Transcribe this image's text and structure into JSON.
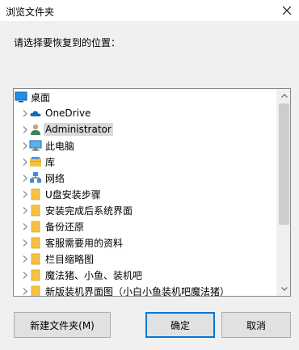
{
  "window": {
    "title": "浏览文件夹",
    "prompt": "请选择要恢复到的位置："
  },
  "tree": {
    "items": [
      {
        "label": "桌面",
        "icon": "desktop-icon",
        "expander": false,
        "level": 0,
        "selected": false
      },
      {
        "label": "OneDrive",
        "icon": "onedrive-cloud-icon",
        "expander": true,
        "level": 1,
        "selected": false
      },
      {
        "label": "Administrator",
        "icon": "user-icon",
        "expander": true,
        "level": 1,
        "selected": true
      },
      {
        "label": "此电脑",
        "icon": "computer-icon",
        "expander": true,
        "level": 1,
        "selected": false
      },
      {
        "label": "库",
        "icon": "library-icon",
        "expander": true,
        "level": 1,
        "selected": false
      },
      {
        "label": "网络",
        "icon": "network-icon",
        "expander": true,
        "level": 1,
        "selected": false
      },
      {
        "label": "U盘安装步骤",
        "icon": "folder-icon",
        "expander": true,
        "level": 1,
        "selected": false
      },
      {
        "label": "安装完成后系统界面",
        "icon": "folder-icon",
        "expander": true,
        "level": 1,
        "selected": false
      },
      {
        "label": "备份还原",
        "icon": "folder-icon",
        "expander": true,
        "level": 1,
        "selected": false
      },
      {
        "label": "客服需要用的资料",
        "icon": "folder-icon",
        "expander": true,
        "level": 1,
        "selected": false
      },
      {
        "label": "栏目缩略图",
        "icon": "folder-icon",
        "expander": true,
        "level": 1,
        "selected": false
      },
      {
        "label": "魔法猪、小鱼、装机吧",
        "icon": "folder-icon",
        "expander": true,
        "level": 1,
        "selected": false
      },
      {
        "label": "新版装机界面图（小白小鱼装机吧魔法猪）",
        "icon": "folder-icon",
        "expander": true,
        "level": 1,
        "selected": false
      }
    ],
    "scroll_fraction": 0.0
  },
  "buttons": {
    "new_folder": "新建文件夹(M)",
    "ok": "确定",
    "cancel": "取消"
  },
  "colors": {
    "accent": "#0078d7",
    "folder": "#f5c242",
    "selection": "#d9d9d9"
  }
}
